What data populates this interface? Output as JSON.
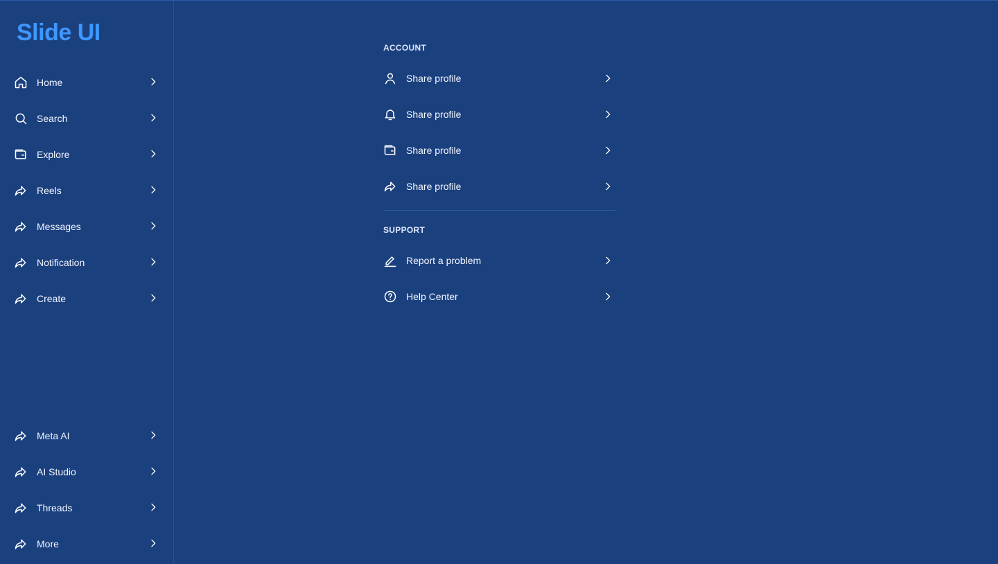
{
  "app": {
    "logo": "Slide UI",
    "colors": {
      "background": "#1b407e",
      "logo": "#3f97ff",
      "text": "#f2f6ff",
      "divider": "#2f5ea6"
    }
  },
  "sidebar": {
    "top_items": [
      {
        "label": "Home",
        "icon": "home-icon"
      },
      {
        "label": "Search",
        "icon": "search-icon"
      },
      {
        "label": "Explore",
        "icon": "wallet-icon"
      },
      {
        "label": "Reels",
        "icon": "share-arrow-icon"
      },
      {
        "label": "Messages",
        "icon": "share-arrow-icon"
      },
      {
        "label": "Notification",
        "icon": "share-arrow-icon"
      },
      {
        "label": "Create",
        "icon": "share-arrow-icon"
      }
    ],
    "bottom_items": [
      {
        "label": "Meta AI",
        "icon": "share-arrow-icon"
      },
      {
        "label": "AI Studio",
        "icon": "share-arrow-icon"
      },
      {
        "label": "Threads",
        "icon": "share-arrow-icon"
      },
      {
        "label": "More",
        "icon": "share-arrow-icon"
      }
    ]
  },
  "settings": {
    "account": {
      "title": "ACCOUNT",
      "items": [
        {
          "label": "Share profile",
          "icon": "user-icon"
        },
        {
          "label": "Share profile",
          "icon": "bell-icon"
        },
        {
          "label": "Share profile",
          "icon": "wallet-icon"
        },
        {
          "label": "Share profile",
          "icon": "share-arrow-icon"
        }
      ]
    },
    "support": {
      "title": "SUPPORT",
      "items": [
        {
          "label": "Report a problem",
          "icon": "pencil-icon"
        },
        {
          "label": "Help Center",
          "icon": "help-circle-icon"
        }
      ]
    }
  }
}
